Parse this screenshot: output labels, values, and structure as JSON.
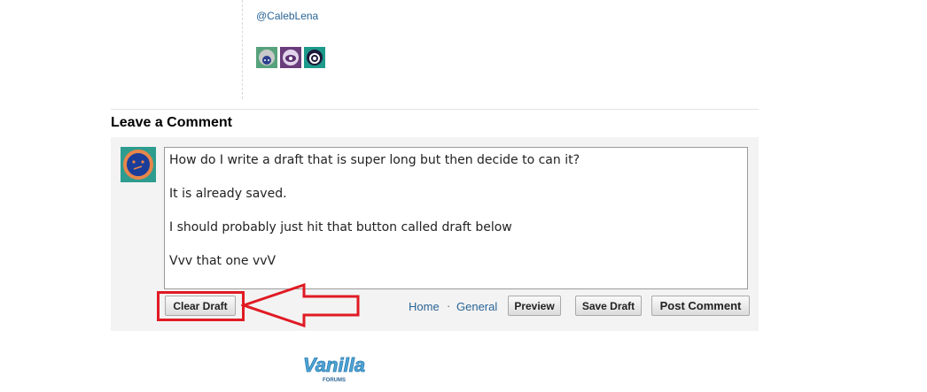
{
  "post": {
    "mention": "@CalebLena",
    "participant_icons": [
      "user-avatar-1-icon",
      "user-avatar-2-icon",
      "user-avatar-3-icon"
    ]
  },
  "comment_form": {
    "heading": "Leave a Comment",
    "avatar_icon": "user-avatar-icon",
    "editor_lines": [
      "How do I write a draft that is super long but then decide to can it?",
      "It is already saved.",
      "I should probably just hit that button called draft below",
      "Vvv that one vvV"
    ],
    "buttons": {
      "clear_draft": "Clear Draft",
      "preview": "Preview",
      "save_draft": "Save Draft",
      "post_comment": "Post Comment"
    },
    "breadcrumb": {
      "home": "Home",
      "separator": "·",
      "category": "General"
    }
  },
  "annotation": {
    "highlight_color": "#e01b24",
    "arrow_icon": "left-arrow-icon"
  },
  "footer": {
    "logo_text": "Vanilla",
    "logo_subtext": "FORUMS",
    "logo_color": "#4fa6d6"
  },
  "colors": {
    "link": "#2a6496",
    "form_background": "#f3f3f3"
  }
}
